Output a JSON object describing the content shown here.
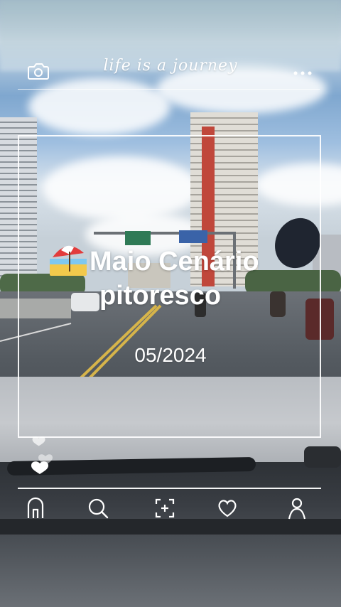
{
  "header": {
    "tagline": "life is a journey",
    "camera_icon": "camera-icon",
    "more_icon": "more-dots-icon"
  },
  "card": {
    "emoji": "beach-umbrella-icon",
    "title_line1": "Maio Cenário",
    "title_line2": "pitoresco",
    "date": "05/2024"
  },
  "like_icon": "heart-icon",
  "nav": {
    "items": [
      {
        "icon": "home-icon"
      },
      {
        "icon": "search-icon"
      },
      {
        "icon": "add-photo-icon"
      },
      {
        "icon": "favorite-icon"
      },
      {
        "icon": "profile-icon"
      }
    ]
  },
  "colors": {
    "overlay": "#ffffff"
  }
}
